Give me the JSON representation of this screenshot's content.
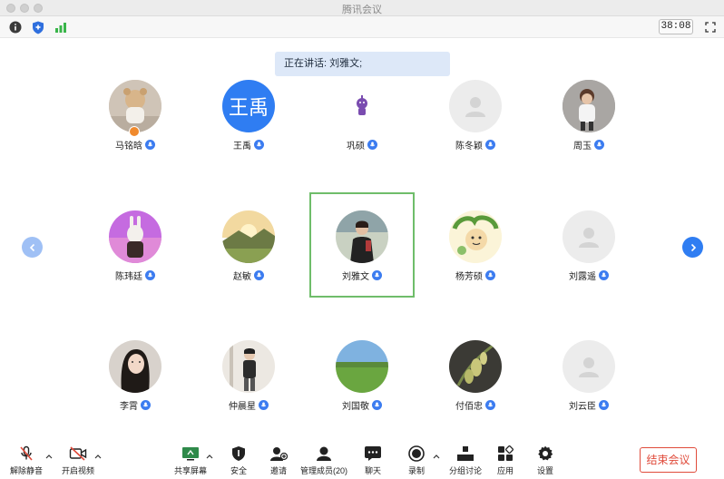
{
  "window": {
    "title": "腾讯会议"
  },
  "topbar": {
    "timer": "38:08"
  },
  "speaking": {
    "text": "正在讲话: 刘雅文;"
  },
  "participants": [
    {
      "name": "马铭晗",
      "avatar": "teddy-bear-photo",
      "host": true
    },
    {
      "name": "王禹",
      "avatar": "initials",
      "initials": "王禹"
    },
    {
      "name": "巩硕",
      "avatar": "cartoon-figure"
    },
    {
      "name": "陈冬颖",
      "avatar": "default-person"
    },
    {
      "name": "周玉",
      "avatar": "child-photo"
    },
    {
      "name": "陈玮廷",
      "avatar": "rabbit-figure"
    },
    {
      "name": "赵敏",
      "avatar": "landscape-photo"
    },
    {
      "name": "刘雅文",
      "avatar": "person-photo",
      "active": true
    },
    {
      "name": "杨芳硕",
      "avatar": "cartoon-drawing"
    },
    {
      "name": "刘露遥",
      "avatar": "default-person"
    },
    {
      "name": "李霄",
      "avatar": "portrait-photo"
    },
    {
      "name": "仲晨星",
      "avatar": "person-photo"
    },
    {
      "name": "刘国敬",
      "avatar": "grassland-photo"
    },
    {
      "name": "付佰忠",
      "avatar": "plant-photo"
    },
    {
      "name": "刘云臣",
      "avatar": "default-person"
    }
  ],
  "toolbar": {
    "unmute": "解除静音",
    "start_video": "开启视频",
    "share_screen": "共享屏幕",
    "security": "安全",
    "invite": "邀请",
    "manage_members": "管理成员(20)",
    "chat": "聊天",
    "record": "录制",
    "breakout": "分组讨论",
    "apps": "应用",
    "settings": "设置",
    "end_meeting": "结束会议"
  },
  "colors": {
    "accent": "#3c7cf0",
    "active_border": "#6fbd6a",
    "end_red": "#e04b3b"
  }
}
